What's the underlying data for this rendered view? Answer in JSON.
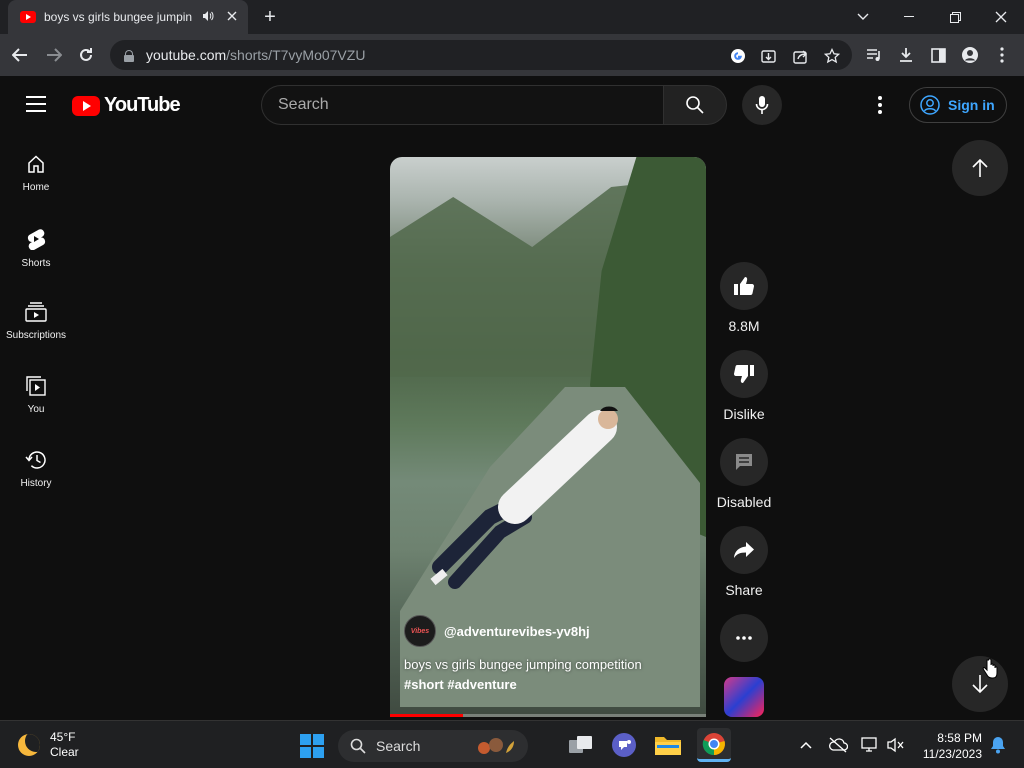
{
  "browser": {
    "tab_title": "boys vs girls bungee jumping",
    "url_host": "youtube.com",
    "url_path": "/shorts/T7vyMo07VZU"
  },
  "youtube": {
    "logo_text": "YouTube",
    "search_placeholder": "Search",
    "signin_label": "Sign in",
    "sidebar": [
      {
        "label": "Home",
        "icon": "home-icon"
      },
      {
        "label": "Shorts",
        "icon": "shorts-icon"
      },
      {
        "label": "Subscriptions",
        "icon": "subscriptions-icon"
      },
      {
        "label": "You",
        "icon": "you-icon"
      },
      {
        "label": "History",
        "icon": "history-icon"
      }
    ],
    "short": {
      "channel": "@adventurevibes-yv8hj",
      "title": "boys vs girls bungee jumping competition",
      "tags": "#short #adventure",
      "progress": 0.23
    },
    "actions": {
      "like_count": "8.8M",
      "dislike_label": "Dislike",
      "comments_label": "Disabled",
      "share_label": "Share"
    }
  },
  "taskbar": {
    "temperature": "45°F",
    "condition": "Clear",
    "search_label": "Search",
    "time": "8:58 PM",
    "date": "11/23/2023"
  },
  "colors": {
    "accent_red": "#ff0000",
    "link_blue": "#3ea6ff"
  }
}
